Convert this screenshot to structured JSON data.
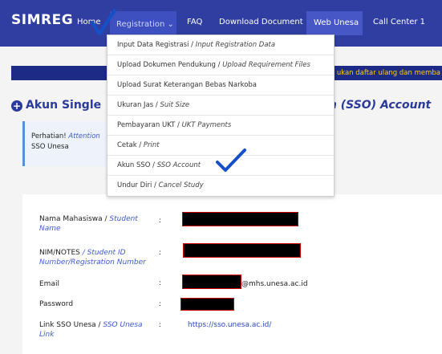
{
  "nav": {
    "brand": "SIMREG",
    "home": "Home",
    "registration": "Registration ⌄",
    "faq": "FAQ",
    "download": "Download Document",
    "web": "Web Unesa",
    "callcenter": "Call Center 1"
  },
  "marquee": "ukan daftar ulang dan memba",
  "heading": {
    "left": "Akun Single",
    "right": "On (SSO) Account"
  },
  "alert": {
    "strong": "Perhatian!",
    "italic": "Attention",
    "line2": "SSO Unesa"
  },
  "menu": [
    {
      "label": "Input Data Registrasi / ",
      "label_en": "Input Registration Data"
    },
    {
      "label": "Upload Dokumen Pendukung / ",
      "label_en": "Upload Requirement Files"
    },
    {
      "label": "Upload Surat Keterangan Bebas Narkoba",
      "label_en": ""
    },
    {
      "label": "Ukuran Jas / ",
      "label_en": "Suit Size"
    },
    {
      "label": "Pembayaran UKT / ",
      "label_en": "UKT Payments"
    },
    {
      "label": "Cetak / ",
      "label_en": "Print"
    },
    {
      "label": "Akun SSO / ",
      "label_en": "SSO Account"
    },
    {
      "label": "Undur Diri / ",
      "label_en": "Cancel Study"
    }
  ],
  "form": {
    "name_label": "Nama Mahasiswa / ",
    "name_label_en": "Student",
    "name_label_en2": "Name",
    "nim_label": "NIM/NOTES",
    "nim_label_en": " / Student ID",
    "nim_label_en2": "Number/Registration Number",
    "email_label": "Email",
    "email_suffix": "@mhs.unesa.ac.id",
    "password_label": "Password",
    "sso_label": "Link SSO Unesa / ",
    "sso_label_en": "SSO Unesa",
    "sso_label_en2": "Link",
    "sso_link": "https://sso.unesa.ac.id/",
    "colon": ":"
  },
  "colors": {
    "navbar": "#2f3ea0",
    "accent": "#2a3a9a",
    "check": "#1450c8",
    "marquee_text": "#ffd400"
  }
}
